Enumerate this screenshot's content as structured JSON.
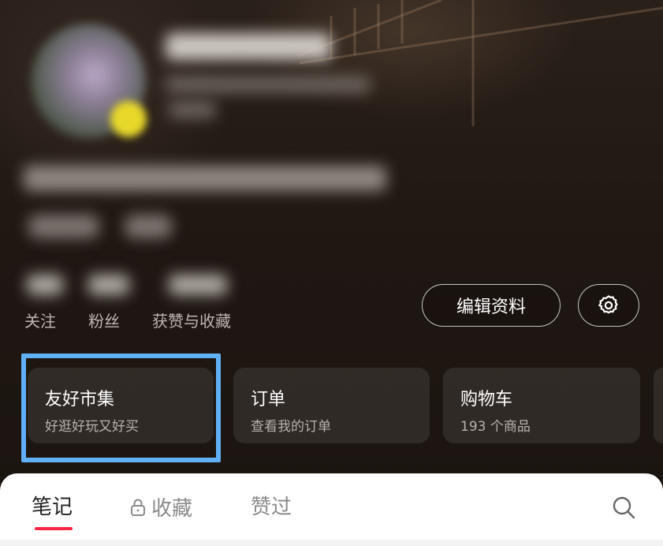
{
  "profile": {
    "stats": [
      {
        "label": "关注"
      },
      {
        "label": "粉丝"
      },
      {
        "label": "获赞与收藏"
      }
    ],
    "edit_label": "编辑资料",
    "settings_icon": "gear-icon"
  },
  "cards": [
    {
      "title": "友好市集",
      "subtitle": "好逛好玩又好买"
    },
    {
      "title": "订单",
      "subtitle": "查看我的订单"
    },
    {
      "title": "购物车",
      "subtitle": "193 个商品"
    }
  ],
  "tabs": {
    "notes": "笔记",
    "favorites": "收藏",
    "likes": "赞过",
    "favorites_icon": "lock-icon",
    "search_icon": "search-icon"
  },
  "colors": {
    "accent": "#ff2442",
    "highlight": "#5fb0f5"
  }
}
